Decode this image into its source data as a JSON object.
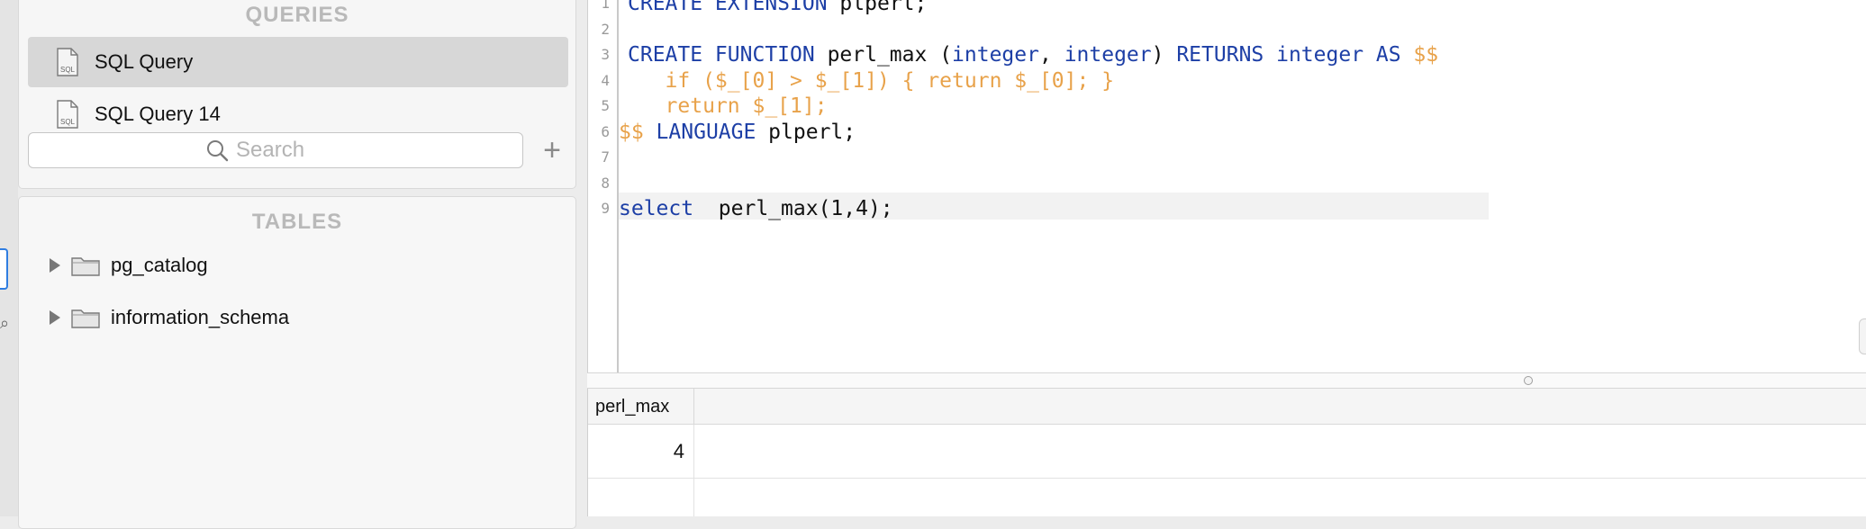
{
  "sidebar": {
    "queries_title": "QUERIES",
    "queries": [
      {
        "label": "SQL Query",
        "icon": "sql-file-icon",
        "active": true
      },
      {
        "label": "SQL Query 14",
        "icon": "sql-file-icon",
        "active": false
      }
    ],
    "search_placeholder": "Search",
    "tables_title": "TABLES",
    "schemas": [
      {
        "label": "pg_catalog",
        "icon": "folder-icon"
      },
      {
        "label": "information_schema",
        "icon": "folder-icon"
      }
    ]
  },
  "editor": {
    "line_numbers": [
      "1",
      "2",
      "3",
      "4",
      "5",
      "6",
      "7",
      "8",
      "9"
    ],
    "lines": [
      [
        {
          "t": "CREATE EXTENSION",
          "c": "kw"
        },
        {
          "t": " plperl;",
          "c": "plain"
        }
      ],
      [],
      [
        {
          "t": "CREATE FUNCTION",
          "c": "kw"
        },
        {
          "t": " perl_max (",
          "c": "plain"
        },
        {
          "t": "integer",
          "c": "kw"
        },
        {
          "t": ", ",
          "c": "plain"
        },
        {
          "t": "integer",
          "c": "kw"
        },
        {
          "t": ") ",
          "c": "plain"
        },
        {
          "t": "RETURNS integer AS",
          "c": "kw"
        },
        {
          "t": " $$",
          "c": "str"
        }
      ],
      [
        {
          "t": "   if ($_[0] > $_[1]) { return $_[0]; }",
          "c": "str"
        }
      ],
      [
        {
          "t": "   return $_[1];",
          "c": "str"
        }
      ],
      [
        {
          "t": "$$",
          "c": "str"
        },
        {
          "t": " LANGUAGE",
          "c": "kw"
        },
        {
          "t": " plperl;",
          "c": "plain"
        }
      ],
      [],
      [],
      [
        {
          "t": "select",
          "c": "kw"
        },
        {
          "t": "  perl_max(1,4);",
          "c": "plain"
        }
      ]
    ]
  },
  "results": {
    "columns": [
      "perl_max"
    ],
    "rows": [
      [
        "4"
      ]
    ]
  },
  "colors": {
    "keyword": "#1d3fa6",
    "string": "#e8a24a",
    "selection_border": "#2f7de1"
  }
}
